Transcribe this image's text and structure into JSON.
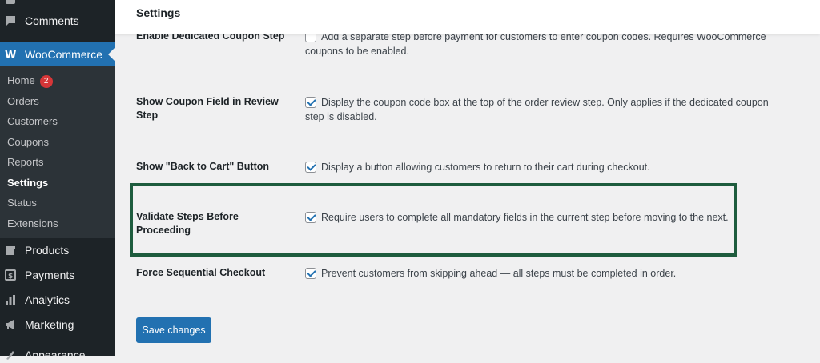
{
  "sidebar": {
    "comments": "Comments",
    "woocommerce": "WooCommerce",
    "submenu": [
      {
        "label": "Home",
        "badge": "2"
      },
      {
        "label": "Orders"
      },
      {
        "label": "Customers"
      },
      {
        "label": "Coupons"
      },
      {
        "label": "Reports"
      },
      {
        "label": "Settings",
        "current": true
      },
      {
        "label": "Status"
      },
      {
        "label": "Extensions"
      }
    ],
    "products": "Products",
    "payments": "Payments",
    "analytics": "Analytics",
    "marketing": "Marketing",
    "appearance": "Appearance"
  },
  "header": {
    "title": "Settings"
  },
  "settings": [
    {
      "label": "Enable Dedicated Coupon Step",
      "checked": false,
      "description": "Add a separate step before payment for customers to enter coupon codes. Requires WooCommerce coupons to be enabled."
    },
    {
      "label": "Show Coupon Field in Review Step",
      "checked": true,
      "description": "Display the coupon code box at the top of the order review step. Only applies if the dedicated coupon step is disabled."
    },
    {
      "label": "Show \"Back to Cart\" Button",
      "checked": true,
      "description": "Display a button allowing customers to return to their cart during checkout."
    },
    {
      "label": "Validate Steps Before Proceeding",
      "checked": true,
      "description": "Require users to complete all mandatory fields in the current step before moving to the next."
    },
    {
      "label": "Force Sequential Checkout",
      "checked": true,
      "description": "Prevent customers from skipping ahead — all steps must be completed in order."
    }
  ],
  "save_button": "Save changes",
  "colors": {
    "accent": "#2271b1",
    "highlight_border": "#1e5c3e",
    "sidebar_bg": "#1d2327"
  }
}
